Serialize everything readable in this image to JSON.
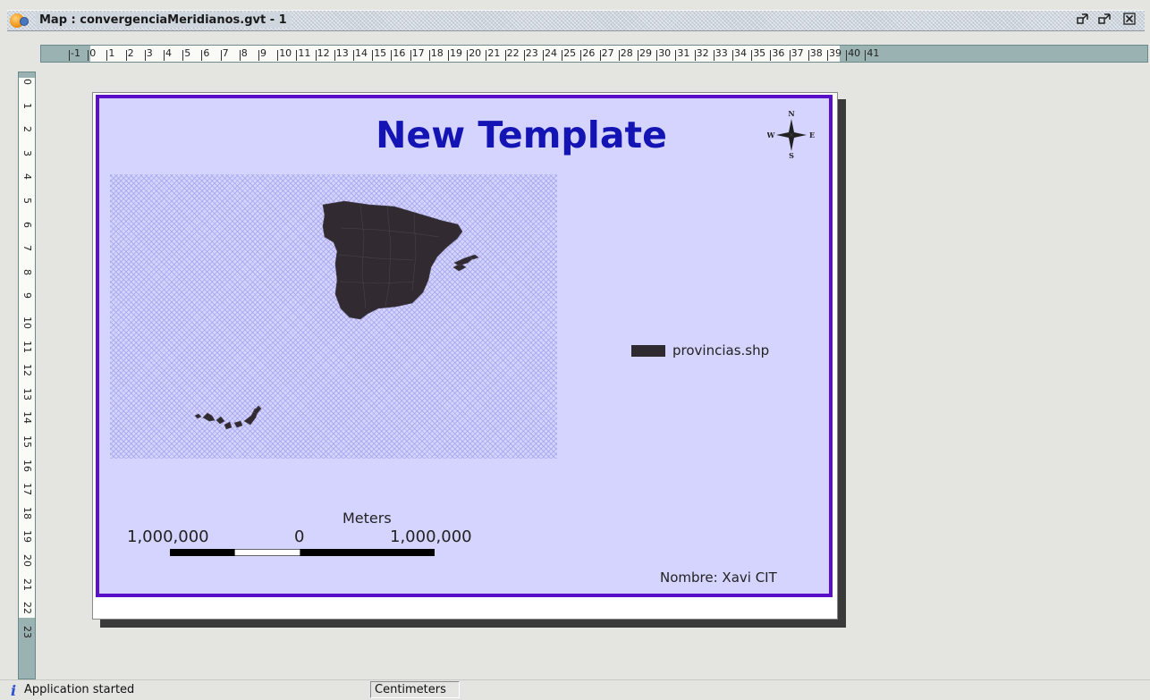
{
  "window": {
    "title": "Map : convergenciaMeridianos.gvt - 1",
    "buttons": [
      "restore-icon",
      "minimize-icon",
      "close-icon"
    ]
  },
  "rulers": {
    "horizontal_labels": [
      "-1",
      "0",
      "1",
      "2",
      "3",
      "4",
      "5",
      "6",
      "7",
      "8",
      "9",
      "10",
      "11",
      "12",
      "13",
      "14",
      "15",
      "16",
      "17",
      "18",
      "19",
      "20",
      "21",
      "22",
      "23",
      "24",
      "25",
      "26",
      "27",
      "28",
      "29",
      "30",
      "31",
      "32",
      "33",
      "34",
      "35",
      "36",
      "37",
      "38",
      "39",
      "40",
      "41"
    ],
    "vertical_labels": [
      "0",
      "1",
      "2",
      "3",
      "4",
      "5",
      "6",
      "7",
      "8",
      "9",
      "10",
      "11",
      "12",
      "13",
      "14",
      "15",
      "16",
      "17",
      "18",
      "19",
      "20",
      "21",
      "22",
      "23"
    ]
  },
  "layout_map": {
    "title": "New Template",
    "north_arrow": {
      "n": "N",
      "s": "S",
      "e": "E",
      "w": "W"
    },
    "legend": {
      "layer": "provincias.shp",
      "color": "#2e2a30"
    },
    "scale_bar": {
      "units": "Meters",
      "left_label": "1,000,000",
      "center_label": "0",
      "right_label": "1,000,000"
    },
    "author": "Nombre: Xavi CIT",
    "frame_color": "#5a10c8",
    "background_color": "#d5d4fe",
    "title_color": "#1414b4"
  },
  "statusbar": {
    "message": "Application started",
    "units": "Centimeters"
  }
}
